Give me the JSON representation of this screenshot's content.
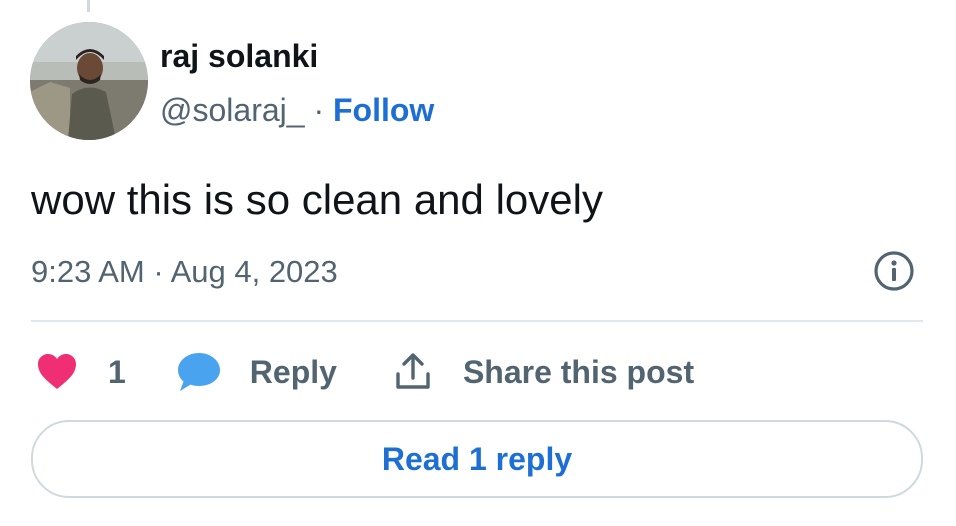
{
  "author": {
    "display_name": "raj solanki",
    "handle": "@solaraj_",
    "separator": " · ",
    "follow_label": "Follow"
  },
  "tweet": {
    "text": "wow this is so clean and lovely",
    "timestamp": "9:23 AM · Aug 4, 2023"
  },
  "actions": {
    "like_count": "1",
    "reply_label": "Reply",
    "share_label": "Share this post"
  },
  "read_replies_label": "Read 1 reply",
  "colors": {
    "like_heart": "#f02e73",
    "reply_bubble": "#4aa3ee",
    "link_blue": "#1d6fd4",
    "secondary_text": "#536471"
  },
  "icons": {
    "avatar": "profile-photo",
    "info": "info-circle-icon",
    "like": "heart-icon",
    "reply": "speech-bubble-icon",
    "share": "share-upload-icon"
  }
}
